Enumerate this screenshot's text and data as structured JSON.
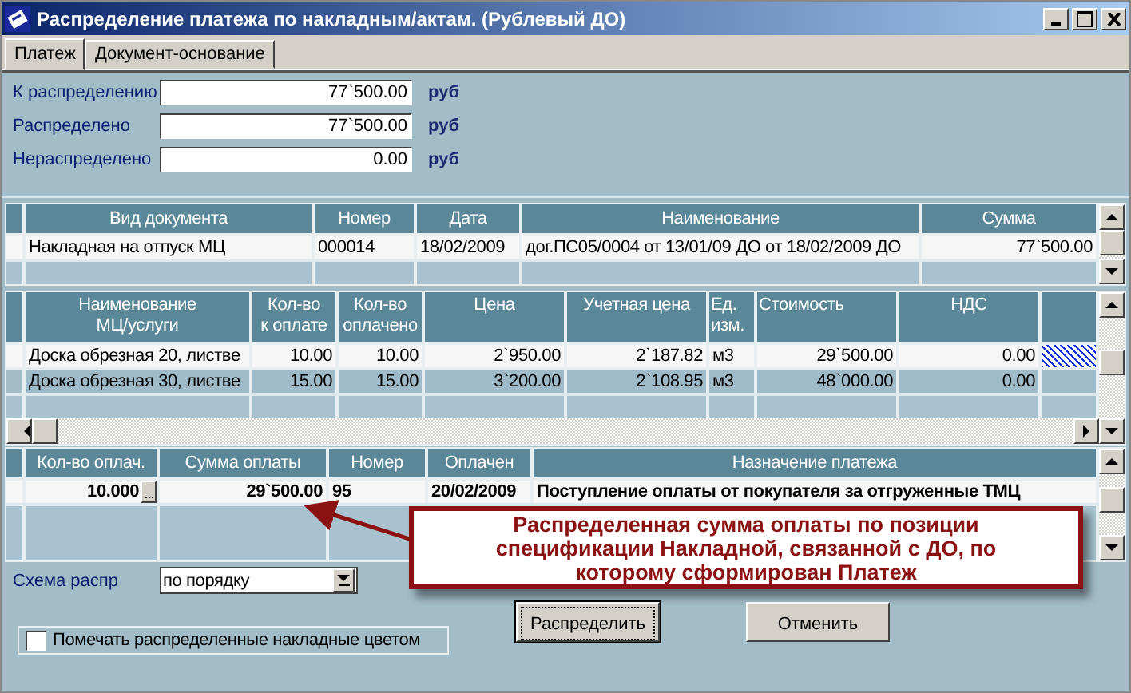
{
  "window": {
    "title": "Распределение платежа по накладным/актам. (Рублевый ДО)"
  },
  "tabs": [
    {
      "label": "Платеж",
      "selected": true
    },
    {
      "label": "Документ-основание",
      "selected": false
    }
  ],
  "summary": [
    {
      "label": "К распределению",
      "value": "77`500.00",
      "unit": "руб"
    },
    {
      "label": "Распределено",
      "value": "77`500.00",
      "unit": "руб"
    },
    {
      "label": "Нераспределено",
      "value": "0.00",
      "unit": "руб"
    }
  ],
  "documents": {
    "columns": [
      "Вид документа",
      "Номер",
      "Дата",
      "Наименование",
      "Сумма"
    ],
    "rows": [
      {
        "selected": true,
        "cells": [
          "Накладная на отпуск МЦ",
          "000014",
          "18/02/2009",
          "дог.ПС05/0004 от 13/01/09 ДО от 18/02/2009 ДО",
          "77`500.00"
        ]
      }
    ]
  },
  "items": {
    "columns": [
      "Наименование\nМЦ/услуги",
      "Кол-во\nк оплате",
      "Кол-во\nоплачено",
      "Цена",
      "Учетная цена",
      "Ед.\nизм.",
      "Стоимость",
      "НДС"
    ],
    "rows": [
      {
        "selected": true,
        "cells": [
          "Доска обрезная 20, листве",
          "10.00",
          "10.00",
          "2`950.00",
          "2`187.82",
          "м3",
          "29`500.00",
          "0.00"
        ]
      },
      {
        "selected": false,
        "cells": [
          "Доска обрезная 30, листве",
          "15.00",
          "15.00",
          "3`200.00",
          "2`108.95",
          "м3",
          "48`000.00",
          "0.00"
        ]
      }
    ]
  },
  "payments": {
    "columns": [
      "Кол-во оплач.",
      "Сумма оплаты",
      "Номер",
      "Оплачен",
      "Назначение платежа"
    ],
    "rows": [
      {
        "selected": true,
        "cells": [
          "10.000",
          "29`500.00",
          "95",
          "20/02/2009",
          "Поступление оплаты от покупателя за отгруженные ТМЦ"
        ]
      }
    ]
  },
  "scheme": {
    "label": "Схема распр",
    "value": "по порядку"
  },
  "buttons": [
    {
      "label": "Распределить",
      "focused": true
    },
    {
      "label": "Отменить",
      "focused": false
    }
  ],
  "mark_checkbox": {
    "label": "Помечать распределенные накладные цветом",
    "checked": false
  },
  "callout": {
    "text": "Распределенная сумма оплаты по позиции спецификации Накладной, связанной с ДО, по которому сформирован Платеж"
  }
}
